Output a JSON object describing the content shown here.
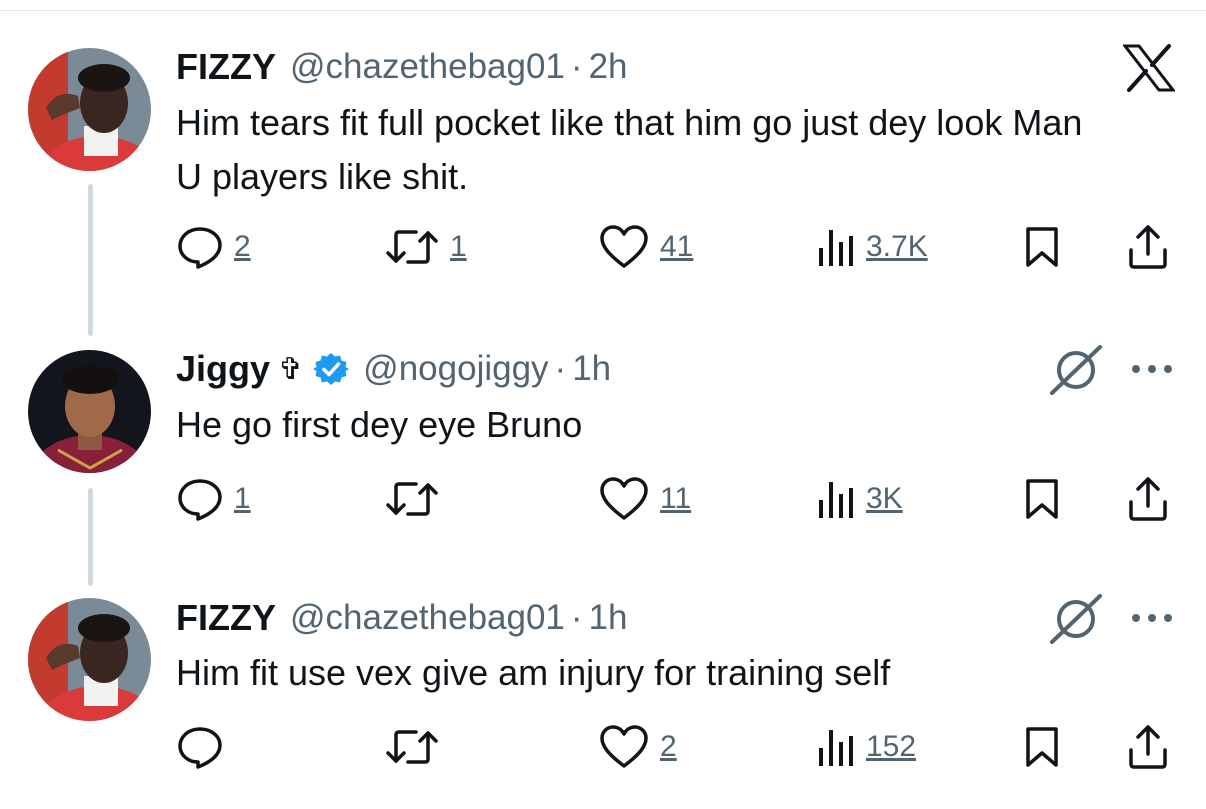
{
  "tweets": [
    {
      "name": "FIZZY",
      "handle": "@chazethebag01",
      "separator": "·",
      "time": "2h",
      "text": "Him tears fit full pocket like that him go just dey look Man U players like shit.",
      "replies": "2",
      "reposts": "1",
      "likes": "41",
      "views": "3.7K",
      "corner_icon": "x-logo-icon"
    },
    {
      "name": "Jiggy",
      "name_symbol": "✞",
      "verified": true,
      "handle": "@nogojiggy",
      "separator": "·",
      "time": "1h",
      "text": "He go first dey eye Bruno",
      "replies": "1",
      "reposts": "",
      "likes": "11",
      "views": "3K",
      "corner_icon": "grok-icon"
    },
    {
      "name": "FIZZY",
      "handle": "@chazethebag01",
      "separator": "·",
      "time": "1h",
      "text": "Him fit use vex give am injury for training self",
      "replies": "",
      "reposts": "",
      "likes": "2",
      "views": "152",
      "corner_icon": "grok-icon"
    }
  ],
  "colors": {
    "text": "#0f1419",
    "secondary": "#536471",
    "verified": "#1d9bf0",
    "thread_line": "#cfd9de"
  }
}
